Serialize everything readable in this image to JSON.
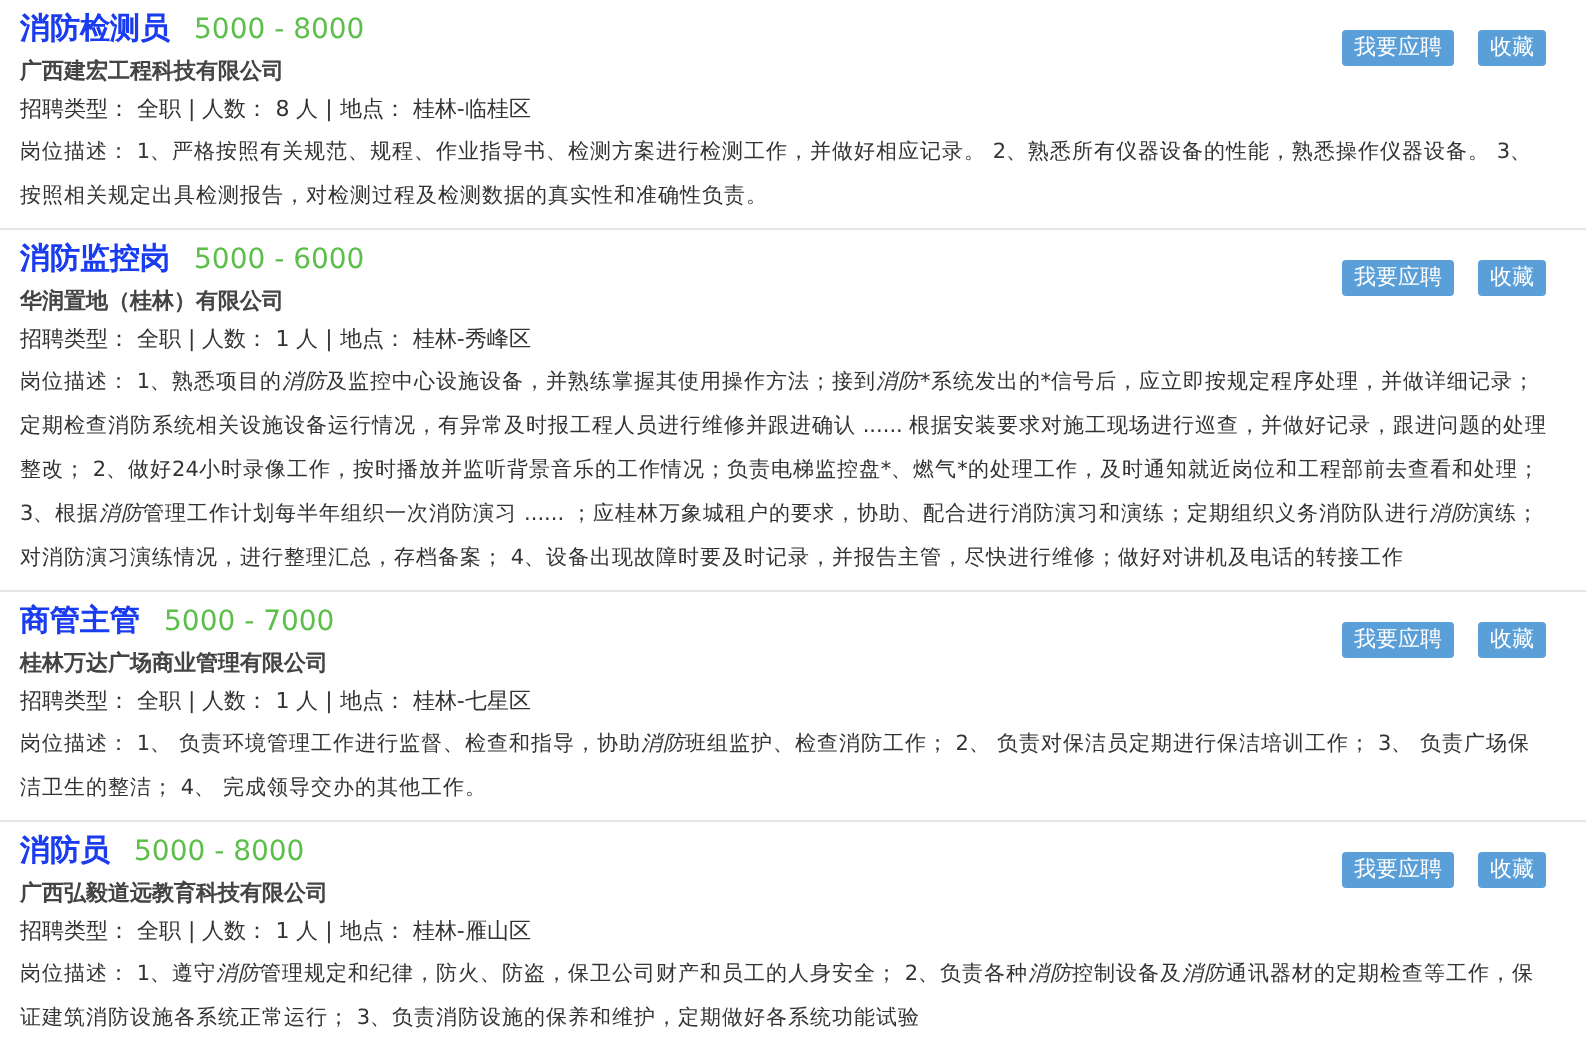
{
  "jobs": [
    {
      "title": "消防检测员",
      "salary": "5000 - 8000",
      "company": "广西建宏工程科技有限公司",
      "info": "招聘类型： 全职 | 人数： 8 人 | 地点： 桂林-临桂区",
      "description": [
        {
          "text": "岗位描述： 1、严格按照有关规范、规程、作业指导书、检测方案进行检测工作，并做好相应记录。 2、熟悉所有仪器设备的性能，熟悉操作仪器设备。 3、按照相关规定出具检测报告，对检测过程及检测数据的真实性和准确性负责。",
          "italic": false
        }
      ],
      "buttons": [
        "我要应聘",
        "收藏"
      ]
    },
    {
      "title": "消防监控岗",
      "salary": "5000 - 6000",
      "company": "华润置地（桂林）有限公司",
      "info": "招聘类型： 全职 | 人数： 1 人 | 地点： 桂林-秀峰区",
      "description": [
        {
          "text": "岗位描述： 1、熟悉项目的",
          "italic": false
        },
        {
          "text": "消防",
          "italic": true
        },
        {
          "text": "及监控中心设施设备，并熟练掌握其使用操作方法；接到",
          "italic": false
        },
        {
          "text": "消防",
          "italic": true
        },
        {
          "text": "*系统发出的*信号后，应立即按规定程序处理，并做详细记录；定期检查消防系统相关设施设备运行情况，有异常及时报工程人员进行维修并跟进确认 ...... 根据安装要求对施工现场进行巡查，并做好记录，跟进问题的处理整改； 2、做好24小时录像工作，按时播放并监听背景音乐的工作情况；负责电梯监控盘*、燃气*的处理工作，及时通知就近岗位和工程部前去查看和处理； 3、根据",
          "italic": false
        },
        {
          "text": "消防",
          "italic": true
        },
        {
          "text": "管理工作计划每半年组织一次消防演习 ...... ；应桂林万象城租户的要求，协助、配合进行消防演习和演练；定期组织义务消防队进行",
          "italic": false
        },
        {
          "text": "消防",
          "italic": true
        },
        {
          "text": "演练；对消防演习演练情况，进行整理汇总，存档备案； 4、设备出现故障时要及时记录，并报告主管，尽快进行维修；做好对讲机及电话的转接工作",
          "italic": false
        }
      ],
      "buttons": [
        "我要应聘",
        "收藏"
      ]
    },
    {
      "title": "商管主管",
      "salary": "5000 - 7000",
      "company": "桂林万达广场商业管理有限公司",
      "info": "招聘类型： 全职 | 人数： 1 人 | 地点： 桂林-七星区",
      "description": [
        {
          "text": "岗位描述： 1、 负责环境管理工作进行监督、检查和指导，协助",
          "italic": false
        },
        {
          "text": "消防",
          "italic": true
        },
        {
          "text": "班组监护、检查消防工作； 2、 负责对保洁员定期进行保洁培训工作； 3、 负责广场保洁卫生的整洁； 4、 完成领导交办的其他工作。",
          "italic": false
        }
      ],
      "buttons": [
        "我要应聘",
        "收藏"
      ]
    },
    {
      "title": "消防员",
      "salary": "5000 - 8000",
      "company": "广西弘毅道远教育科技有限公司",
      "info": "招聘类型： 全职 | 人数： 1 人 | 地点： 桂林-雁山区",
      "description": [
        {
          "text": "岗位描述： 1、遵守",
          "italic": false
        },
        {
          "text": "消防",
          "italic": true
        },
        {
          "text": "管理规定和纪律，防火、防盗，保卫公司财产和员工的人身安全； 2、负责各种",
          "italic": false
        },
        {
          "text": "消防",
          "italic": true
        },
        {
          "text": "控制设备及",
          "italic": false
        },
        {
          "text": "消防",
          "italic": true
        },
        {
          "text": "通讯器材的定期检查等工作，保证建筑消防设施各系统正常运行； 3、负责消防设施的保养和维护，定期做好各系统功能试验",
          "italic": false
        }
      ],
      "buttons": [
        "我要应聘",
        "收藏"
      ]
    }
  ]
}
